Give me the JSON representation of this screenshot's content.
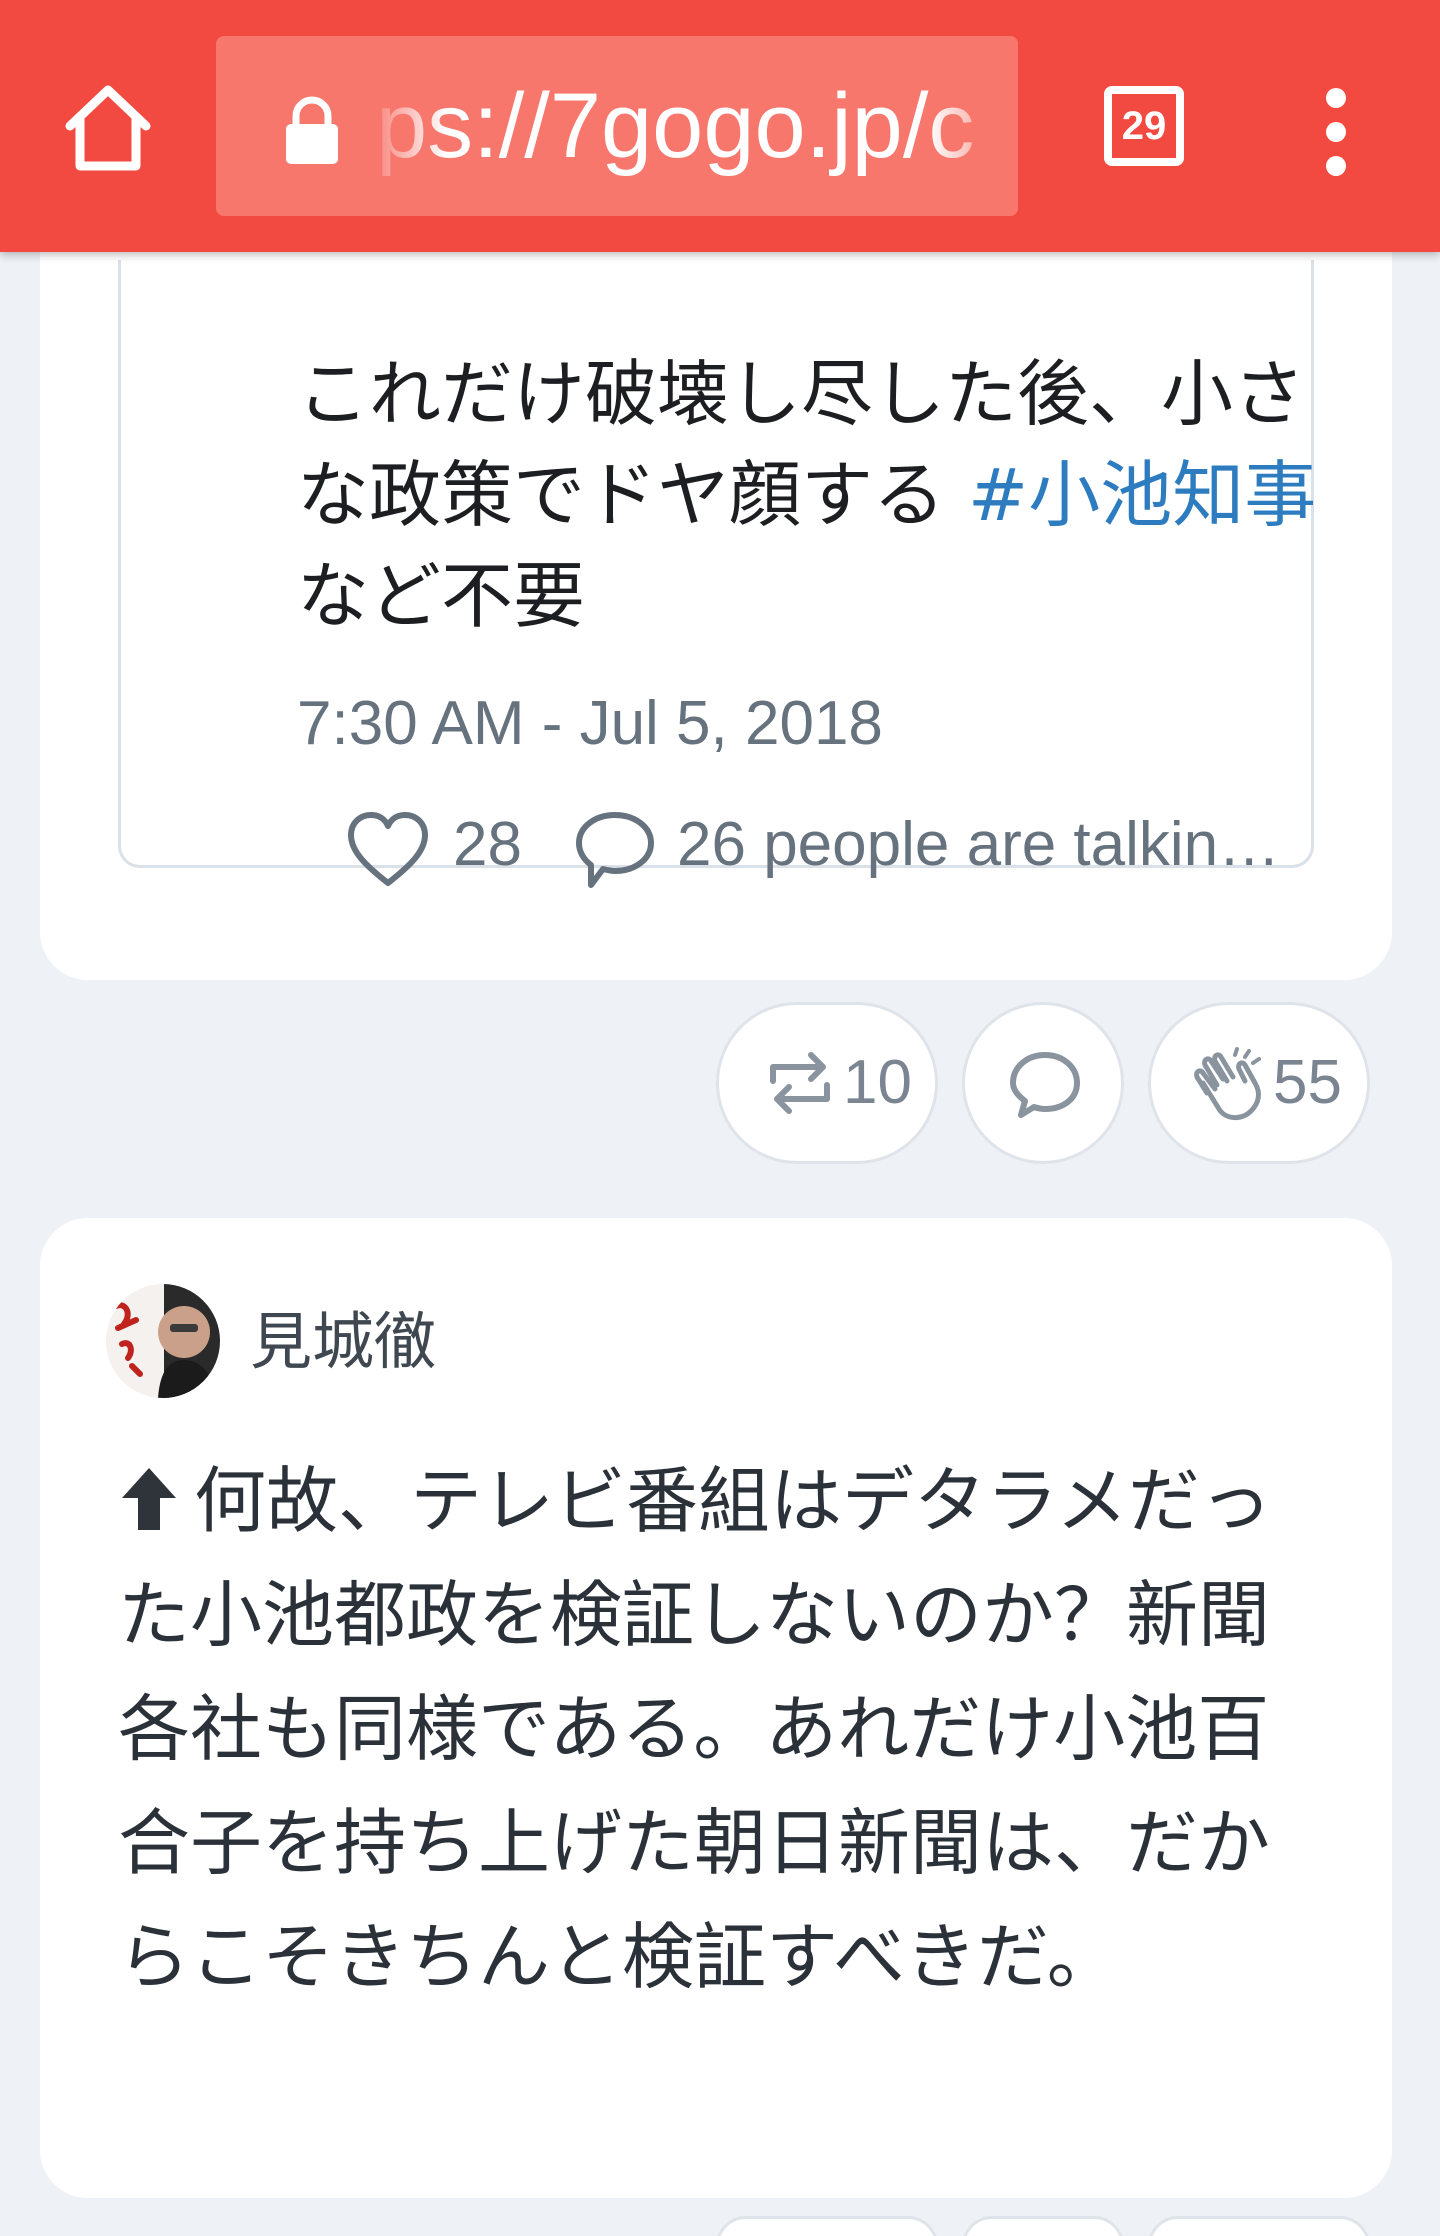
{
  "browser": {
    "url": "ps://7gogo.jp/c",
    "tab_count": "29",
    "home_icon": "home-icon",
    "lock_icon": "lock-icon",
    "menu_icon": "more-vertical-icon",
    "bar_color": "#f24a40"
  },
  "embedded_tweet": {
    "text_part1": "これだけ破壊し尽した後、小さな政策でドヤ顔する ",
    "hashtag": "#小池知事",
    "text_part2": " など不要",
    "time": "7:30 AM - Jul 5, 2018",
    "like_count": "28",
    "talking_text": "26 people are talkin…",
    "hashtag_color": "#2d7cbf"
  },
  "actions": {
    "repost_count": "10",
    "clap_count": "55"
  },
  "post": {
    "author": "見城徹",
    "text": "何故、テレビ番組はデタラメだった小池都政を検証しないのか？新聞各社も同様である。あれだけ小池百合子を持ち上げた朝日新聞は、だからこそきちんと検証すべきだ。"
  }
}
